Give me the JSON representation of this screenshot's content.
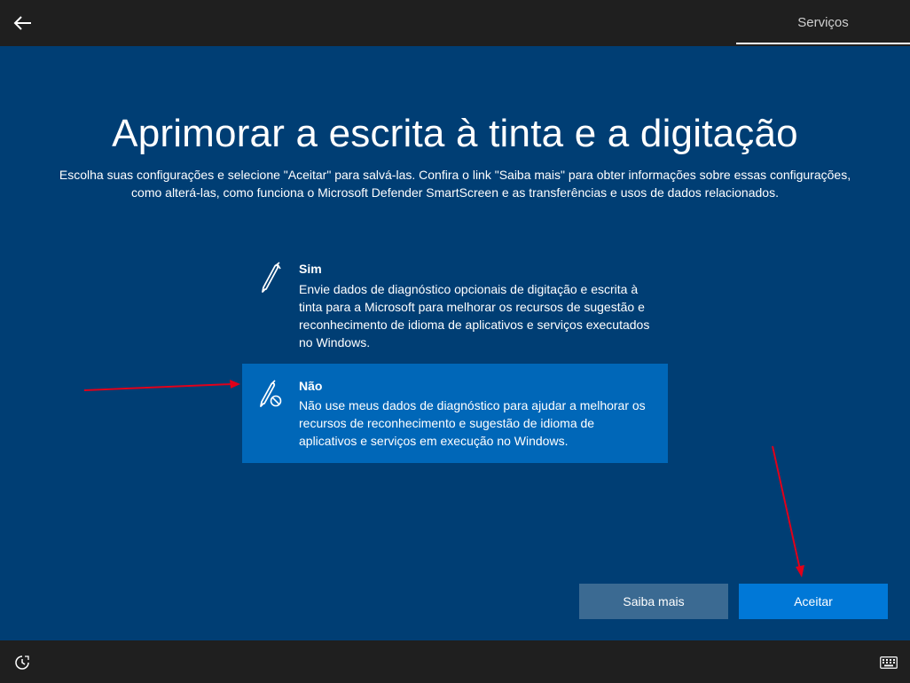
{
  "header": {
    "back_icon": "back-arrow-icon",
    "tab_label": "Serviços"
  },
  "main": {
    "title": "Aprimorar a escrita à tinta e a digitação",
    "subtitle": "Escolha suas configurações e selecione \"Aceitar\" para salvá-las. Confira o link \"Saiba mais\" para obter informações sobre essas configurações, como alterá-las, como funciona o Microsoft Defender SmartScreen e as transferências e usos de dados relacionados.",
    "options": [
      {
        "icon": "pen-icon",
        "title": "Sim",
        "description": "Envie dados de diagnóstico opcionais de digitação e escrita à tinta para a Microsoft para melhorar os recursos de sugestão e reconhecimento de idioma de aplicativos e serviços executados no Windows.",
        "selected": false
      },
      {
        "icon": "pen-disabled-icon",
        "title": "Não",
        "description": "Não use meus dados de diagnóstico para ajudar a melhorar os recursos de reconhecimento e sugestão de idioma de aplicativos e serviços em execução no Windows.",
        "selected": true
      }
    ]
  },
  "buttons": {
    "learn_more": "Saiba mais",
    "accept": "Aceitar"
  },
  "footer": {
    "accessibility_icon": "accessibility-icon",
    "keyboard_icon": "keyboard-icon"
  },
  "colors": {
    "background": "#003e74",
    "selected_option": "#0067b8",
    "accept_button": "#0078d7",
    "learn_more_button": "#3b6a92",
    "annotation_arrow": "#e0001a"
  }
}
